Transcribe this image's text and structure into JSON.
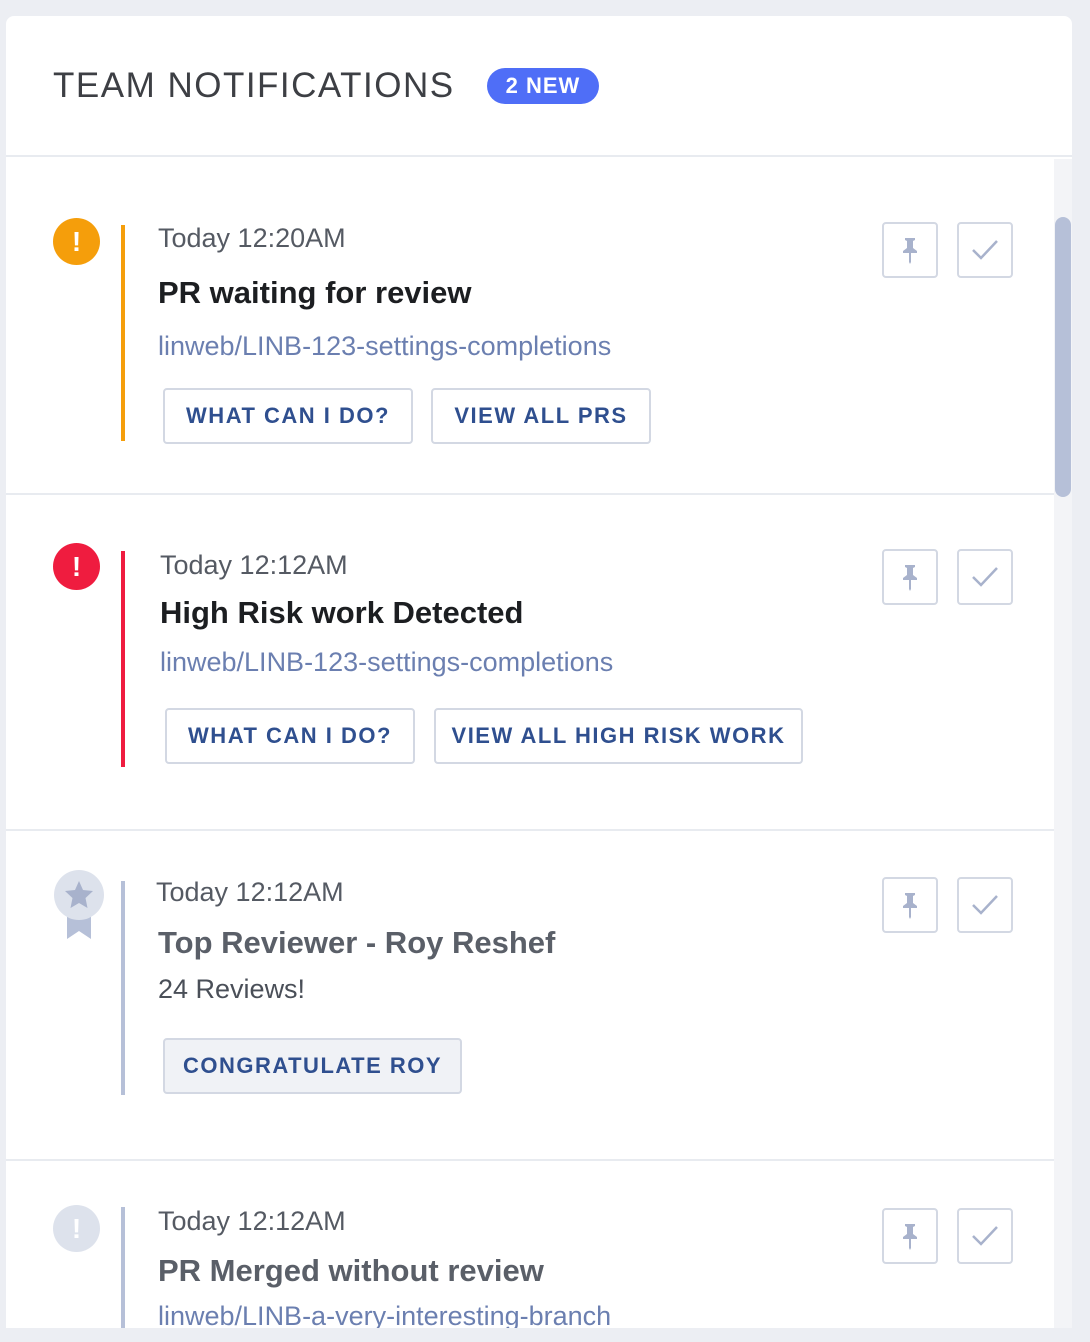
{
  "header": {
    "title": "TEAM NOTIFICATIONS",
    "badge": "2 NEW"
  },
  "colors": {
    "warning": "#f59e0b",
    "danger": "#ef1c3f",
    "neutral": "#b6c0d8",
    "accent": "#4f6ef7"
  },
  "notifications": [
    {
      "time": "Today 12:20AM",
      "title": "PR waiting for review",
      "link": "linweb/LINB-123-settings-completions",
      "icon": "warning-icon",
      "actions": [
        "WHAT CAN I DO?",
        "VIEW ALL PRS"
      ]
    },
    {
      "time": "Today 12:12AM",
      "title": "High Risk work Detected",
      "link": "linweb/LINB-123-settings-completions",
      "icon": "alert-icon",
      "actions": [
        "WHAT CAN I DO?",
        "VIEW ALL HIGH RISK WORK"
      ]
    },
    {
      "time": "Today 12:12AM",
      "title": "Top Reviewer - Roy Reshef",
      "subtext": "24 Reviews!",
      "icon": "award-star-icon",
      "actions": [
        "CONGRATULATE ROY"
      ]
    },
    {
      "time": "Today 12:12AM",
      "title": "PR Merged without review",
      "link": "linweb/LINB-a-very-interesting-branch",
      "icon": "info-alert-icon",
      "actions": []
    }
  ]
}
